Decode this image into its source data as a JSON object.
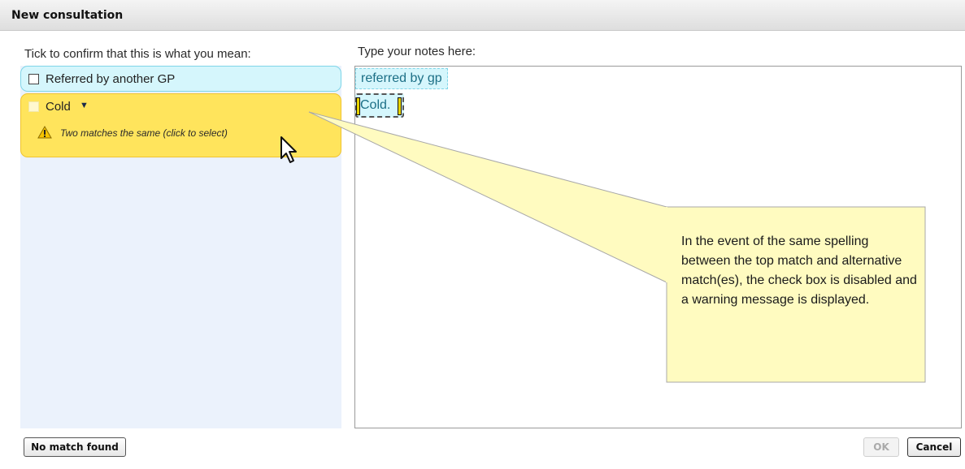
{
  "window": {
    "title": "New consultation"
  },
  "left": {
    "label": "Tick to confirm that this is what you mean:",
    "items": [
      {
        "label": "Referred by another GP",
        "checked": false,
        "disabled": false
      },
      {
        "label": "Cold",
        "checked": false,
        "disabled": true,
        "warning": "Two matches the same (click to select)"
      }
    ]
  },
  "notes": {
    "label": "Type your notes here:",
    "chips": [
      "referred by gp",
      "Cold."
    ]
  },
  "callout": {
    "text": "In the event of the same spelling between the top match and alternative match(es), the check box is disabled and a warning message is displayed."
  },
  "buttons": {
    "no_match": "No match found",
    "ok": "OK",
    "cancel": "Cancel"
  },
  "colors": {
    "match_highlight": "#d5f6fc",
    "warning_highlight": "#ffe45c",
    "callout_bg": "#fffbc0",
    "panel_bg": "#ebf2fc"
  }
}
